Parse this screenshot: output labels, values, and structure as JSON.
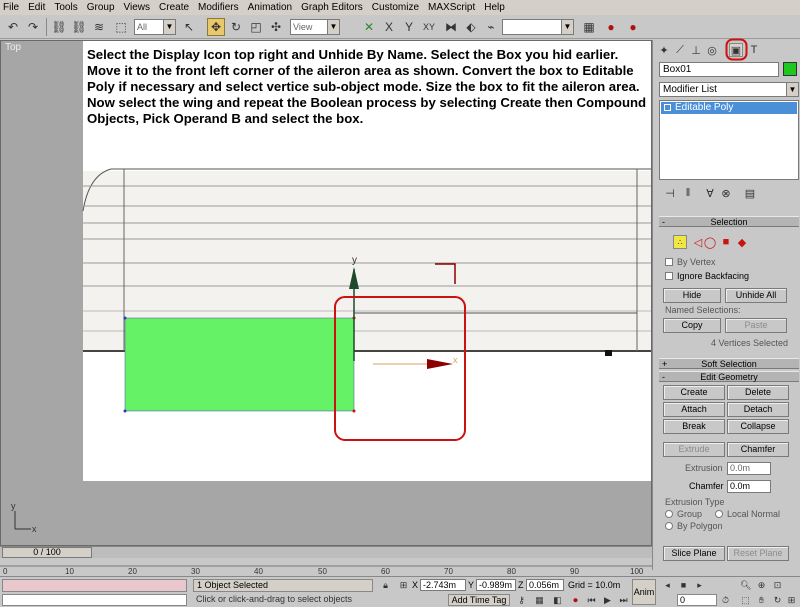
{
  "menu": [
    "File",
    "Edit",
    "Tools",
    "Group",
    "Views",
    "Create",
    "Modifiers",
    "Animation",
    "Graph Editors",
    "Customize",
    "MAXScript",
    "Help"
  ],
  "toolbar": {
    "selection_filter": "All",
    "reference_coord": "View",
    "named_selection": ""
  },
  "viewport": {
    "label": "Top",
    "instruction": "Select the Display Icon top right and Unhide By Name.  Select the Box you hid earlier.  Move it to the front left corner of the aileron area as shown.  Convert the box to Editable Poly if necessary and select vertice sub-object mode.  Size the box to fit the aileron area.  Now select the wing and repeat the Boolean process by selecting Create then Compound Objects, Pick Operand B and select the box.",
    "gizmo_y": "y",
    "gizmo_x": "x",
    "axis_y": "y",
    "axis_x": "x",
    "colors": {
      "box": "#66f266",
      "highlight": "#cc1111",
      "gizmo": "#8b0000"
    }
  },
  "command_panel": {
    "object_name": "Box01",
    "object_color": "#1ec81e",
    "modifier_list": "Modifier List",
    "stack_item": "Editable Poly",
    "selection": {
      "title": "Selection",
      "by_vertex": "By Vertex",
      "ignore_backfacing": "Ignore Backfacing",
      "hide": "Hide",
      "unhide_all": "Unhide All",
      "named_selections": "Named Selections:",
      "copy": "Copy",
      "paste": "Paste",
      "status": "4 Vertices Selected"
    },
    "soft_selection": "Soft Selection",
    "edit_geometry": {
      "title": "Edit Geometry",
      "create": "Create",
      "delete": "Delete",
      "attach": "Attach",
      "detach": "Detach",
      "break": "Break",
      "collapse": "Collapse",
      "extrude": "Extrude",
      "chamfer": "Chamfer",
      "extrusion_label": "Extrusion",
      "extrusion_value": "0.0m",
      "chamfer_label": "Chamfer",
      "chamfer_value": "0.0m",
      "extrusion_type": "Extrusion Type",
      "group": "Group",
      "local_normal": "Local Normal",
      "by_polygon": "By Polygon",
      "slice_plane": "Slice Plane",
      "reset_plane": "Reset Plane"
    }
  },
  "timeline": {
    "frame_label": "0 / 100",
    "ticks": [
      "0",
      "10",
      "20",
      "30",
      "40",
      "50",
      "60",
      "70",
      "80",
      "90",
      "100"
    ]
  },
  "status": {
    "selected": "1 Object Selected",
    "prompt": "Click or click-and-drag to select objects",
    "x_label": "X",
    "x_value": "-2.743m",
    "y_label": "Y",
    "y_value": "-0.989m",
    "z_label": "Z",
    "z_value": "0.056m",
    "grid": "Grid = 10.0m",
    "add_time_tag": "Add Time Tag",
    "anim": "Anim",
    "frame": "0"
  }
}
